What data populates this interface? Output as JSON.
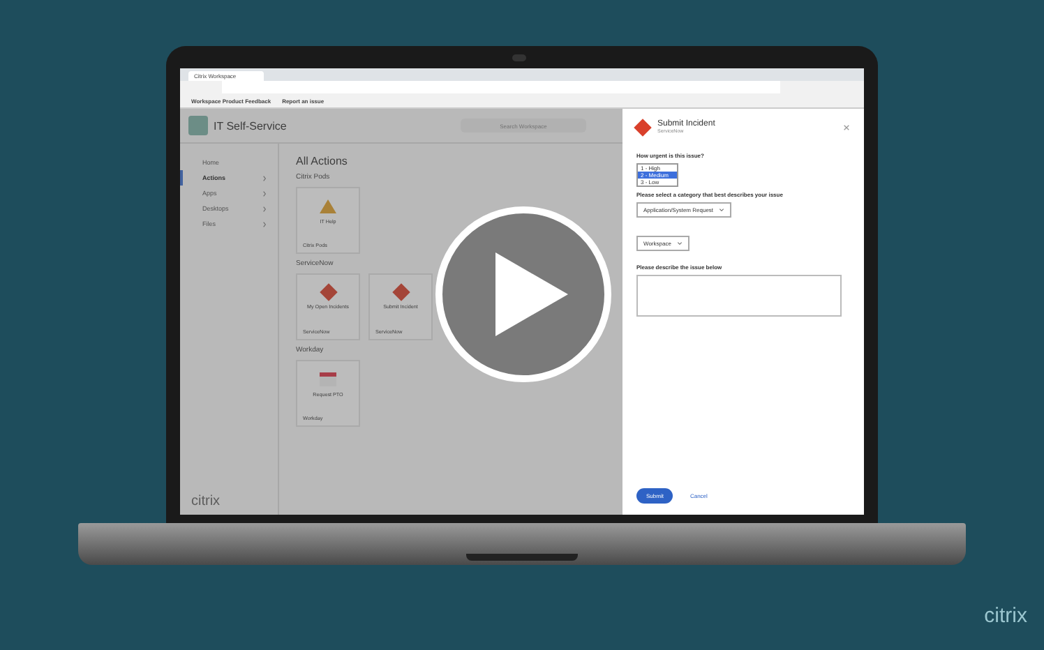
{
  "browser": {
    "tab_title": "Citrix Workspace",
    "bookmarks": [
      "Workspace Product Feedback",
      "Report an issue"
    ]
  },
  "app": {
    "title": "IT Self-Service",
    "search": {
      "placeholder": "Search Workspace"
    },
    "brand": "citrix"
  },
  "sidebar": {
    "items": [
      {
        "label": "Home",
        "selected": false,
        "expandable": false
      },
      {
        "label": "Actions",
        "selected": true,
        "expandable": true
      },
      {
        "label": "Apps",
        "selected": false,
        "expandable": true
      },
      {
        "label": "Desktops",
        "selected": false,
        "expandable": true
      },
      {
        "label": "Files",
        "selected": false,
        "expandable": true
      }
    ]
  },
  "main": {
    "heading": "All Actions",
    "sections": [
      {
        "title": "Citrix Pods",
        "cards": [
          {
            "kind": "warning",
            "label": "IT Help",
            "source": "Citrix Pods"
          }
        ]
      },
      {
        "title": "ServiceNow",
        "cards": [
          {
            "kind": "incident",
            "label": "My Open Incidents",
            "source": "ServiceNow"
          },
          {
            "kind": "incident",
            "label": "Submit Incident",
            "source": "ServiceNow"
          }
        ]
      },
      {
        "title": "Workday",
        "cards": [
          {
            "kind": "calendar",
            "label": "Request PTO",
            "source": "Workday"
          }
        ]
      }
    ]
  },
  "panel": {
    "title": "Submit Incident",
    "subtitle": "ServiceNow",
    "urgency": {
      "label": "How urgent is this issue?",
      "options": [
        {
          "label": "1 - High",
          "selected": false
        },
        {
          "label": "2 - Medium",
          "selected": true
        },
        {
          "label": "3 - Low",
          "selected": false
        }
      ]
    },
    "category": {
      "label": "Please select a category that best describes your issue",
      "value": "Application/System Request"
    },
    "subcategory": {
      "value": "Workspace"
    },
    "description": {
      "label": "Please describe the issue below"
    },
    "buttons": [
      {
        "kind": "primary",
        "label": "Submit"
      },
      {
        "kind": "link",
        "label": "Cancel"
      }
    ]
  },
  "video": {
    "brand": "citrix"
  }
}
